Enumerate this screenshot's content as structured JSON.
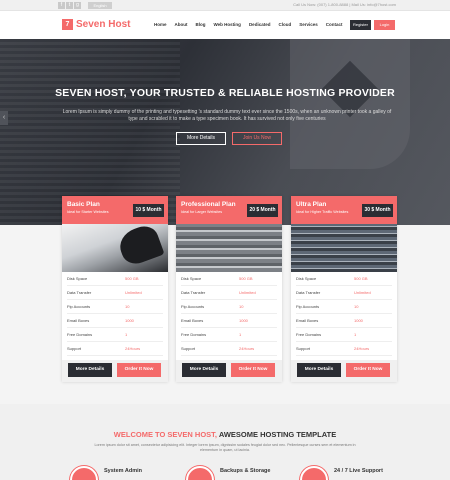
{
  "topbar": {
    "social": [
      "f",
      "t",
      "g"
    ],
    "language": "English",
    "contact": "Call Us Now: (007) 1-800-8888   |   Mail Us: info@7host.com"
  },
  "header": {
    "logo_mark": "7",
    "logo_text": "Seven Host",
    "nav": [
      "Home",
      "About",
      "Blog",
      "Web Hosting",
      "Dedicated",
      "Cloud",
      "Services",
      "Contact"
    ],
    "register": "Register",
    "login": "Login"
  },
  "hero": {
    "title": "SEVEN HOST, YOUR TRUSTED & RELIABLE HOSTING PROVIDER",
    "text": "Lorem Ipsum is simply dummy of the printing and typesetting 's standard dummy text ever since the 1500s, when an unknown printer took a galley of type and scrabled it to make a type specimen book. It has survived not only five centuries",
    "btn_more": "More Details",
    "btn_join": "Join Us Now",
    "arrow": "‹"
  },
  "plans": [
    {
      "name": "Basic Plan",
      "sub": "Ideal for Starter Websites",
      "price": "10 $ Month",
      "rows": [
        [
          "Disk Space",
          "500 GB"
        ],
        [
          "Data Transfer",
          "Unlimited"
        ],
        [
          "Ftp Accounts",
          "10"
        ],
        [
          "Email Boxes",
          "1000"
        ],
        [
          "Free Domains",
          "1"
        ],
        [
          "Support",
          "24Hours"
        ]
      ],
      "more": "More Details",
      "order": "Order It Now"
    },
    {
      "name": "Professional Plan",
      "sub": "Ideal for Larger Websites",
      "price": "20 $ Month",
      "rows": [
        [
          "Disk Space",
          "500 GB"
        ],
        [
          "Data Transfer",
          "Unlimited"
        ],
        [
          "Ftp Accounts",
          "10"
        ],
        [
          "Email Boxes",
          "1000"
        ],
        [
          "Free Domains",
          "1"
        ],
        [
          "Support",
          "24Hours"
        ]
      ],
      "more": "More Details",
      "order": "Order It Now"
    },
    {
      "name": "Ultra Plan",
      "sub": "Ideal for Higher Traffic Websites",
      "price": "30 $ Month",
      "rows": [
        [
          "Disk Space",
          "500 GB"
        ],
        [
          "Data Transfer",
          "Unlimited"
        ],
        [
          "Ftp Accounts",
          "10"
        ],
        [
          "Email Boxes",
          "1000"
        ],
        [
          "Free Domains",
          "1"
        ],
        [
          "Support",
          "24Hours"
        ]
      ],
      "more": "More Details",
      "order": "Order It Now"
    }
  ],
  "welcome": {
    "title_red": "WELCOME TO SEVEN HOST,",
    "title_dark": "AWESOME HOSTING TEMPLATE",
    "text": "Lorem ipsum dolor sit amet, consectetur adipisicing elit. Integer lorem ipsum, dignissim sodales feugiat dolor sed nec. Pellentesque curses sem et elementum in elementum in quam, ut lacinia.",
    "features": [
      "System Admin",
      "Backups & Storage",
      "24 / 7 Live Support"
    ]
  },
  "colors": {
    "accent": "#f46a6a",
    "dark": "#2b2d33"
  }
}
